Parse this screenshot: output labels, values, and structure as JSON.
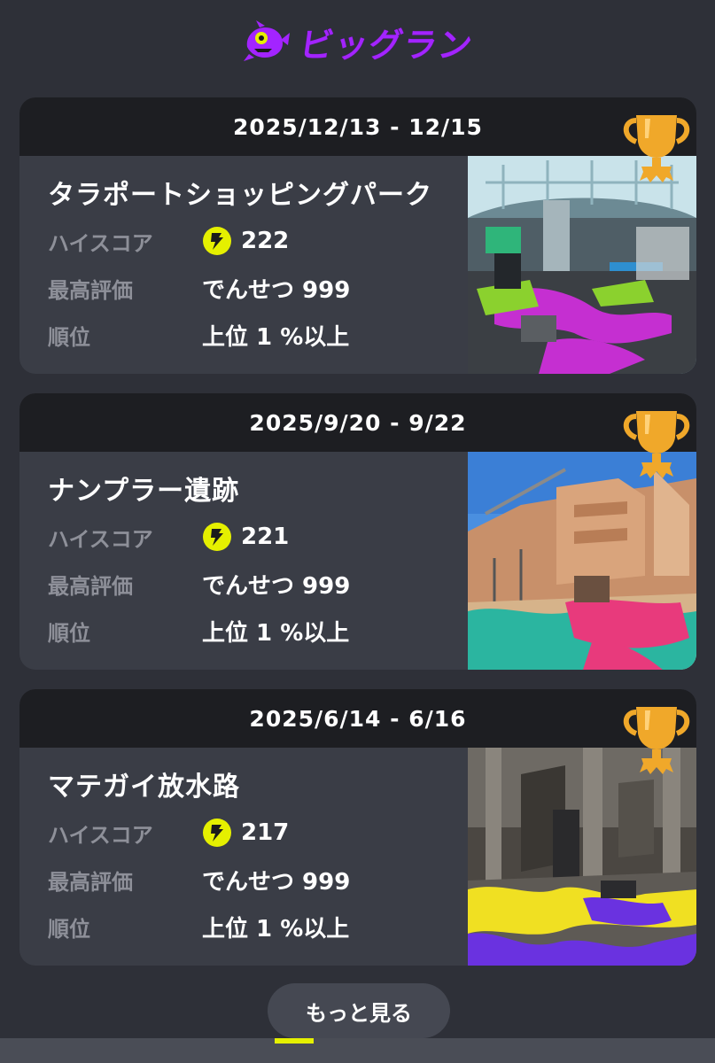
{
  "header": {
    "title": "ビッグラン",
    "logo_icon": "salmonid-icon",
    "accent_color": "#a324ff"
  },
  "labels": {
    "high_score": "ハイスコア",
    "best_rating": "最高評価",
    "rank": "順位"
  },
  "records": [
    {
      "date_range": "2025/12/13 - 12/15",
      "stage": "タラポートショッピングパーク",
      "high_score": "222",
      "best_rating": "でんせつ 999",
      "rank": "上位 1 %以上",
      "thumb_palette": "mall"
    },
    {
      "date_range": "2025/9/20 - 9/22",
      "stage": "ナンプラー遺跡",
      "high_score": "221",
      "best_rating": "でんせつ 999",
      "rank": "上位 1 %以上",
      "thumb_palette": "ruins"
    },
    {
      "date_range": "2025/6/14 - 6/16",
      "stage": "マテガイ放水路",
      "high_score": "217",
      "best_rating": "でんせつ 999",
      "rank": "上位 1 %以上",
      "thumb_palette": "canal"
    }
  ],
  "more_button": {
    "label": "もっと見る"
  },
  "icons": {
    "score": "golden-egg-icon",
    "trophy": "gold-trophy-icon"
  },
  "colors": {
    "trophy": "#f0a82a",
    "score_icon": "#e5f000",
    "card_bg": "#3a3d46",
    "card_header_bg": "#1d1e22"
  }
}
